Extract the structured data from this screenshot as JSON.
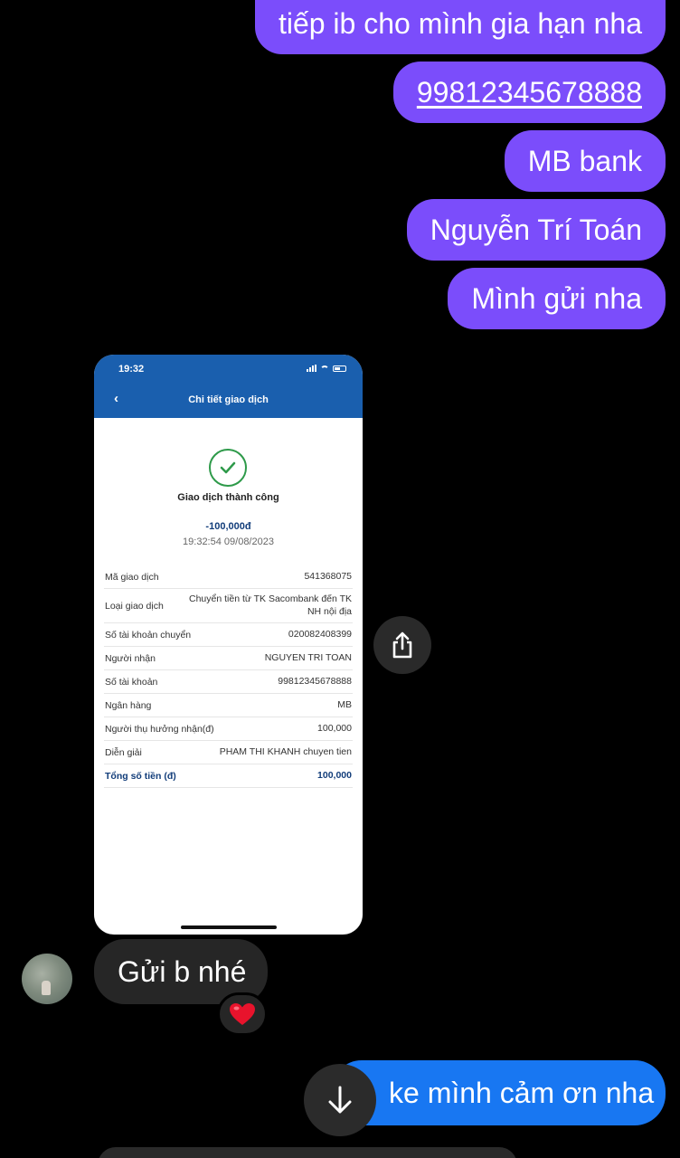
{
  "messages_out": [
    {
      "text": "tiếp ib cho mình gia hạn nha"
    },
    {
      "text": "99812345678888",
      "link": true
    },
    {
      "text": "MB bank"
    },
    {
      "text": "Nguyễn Trí Toán"
    },
    {
      "text": "Mình gửi nha"
    }
  ],
  "shared_image": {
    "status_time": "19:32",
    "header_title": "Chi tiết giao dịch",
    "back_glyph": "‹",
    "result": "Giao dịch thành công",
    "amount": "-100,000đ",
    "datetime": "19:32:54 09/08/2023",
    "rows": [
      {
        "label": "Mã giao dịch",
        "value": "541368075"
      },
      {
        "label": "Loại giao dịch",
        "value": "Chuyển tiền từ TK Sacombank đến TK NH nội địa"
      },
      {
        "label": "Số tài khoản chuyển",
        "value": "020082408399"
      },
      {
        "label": "Người nhận",
        "value": "NGUYEN TRI TOAN"
      },
      {
        "label": "Số tài khoản",
        "value": "99812345678888"
      },
      {
        "label": "Ngân hàng",
        "value": "MB"
      },
      {
        "label": "Người thụ hưởng nhận(đ)",
        "value": "100,000"
      },
      {
        "label": "Diễn giải",
        "value": "PHAM THI KHANH chuyen tien"
      },
      {
        "label": "Tổng số tiền (đ)",
        "value": "100,000"
      }
    ]
  },
  "message_in": {
    "text": "Gửi b nhé",
    "reaction": "❤️"
  },
  "message_out_blue": {
    "text": "ke mình cảm ơn nha"
  },
  "icons": {
    "share": "share-icon",
    "scroll_down": "arrow-down-icon",
    "check": "checkmark-icon"
  },
  "colors": {
    "outgoing": "#7b4dfb",
    "outgoing_blue": "#1877f2",
    "incoming": "#262626",
    "bank_header": "#1a5fae",
    "success": "#2e9a4a"
  }
}
